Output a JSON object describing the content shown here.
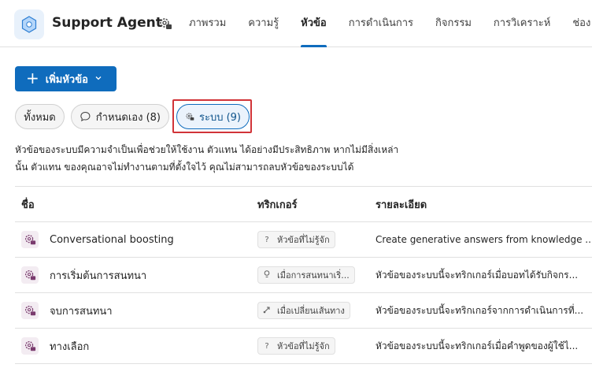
{
  "app": {
    "title": "Support Agent"
  },
  "tabs": [
    {
      "label": "ภาพรวม"
    },
    {
      "label": "ความรู้"
    },
    {
      "label": "หัวข้อ"
    },
    {
      "label": "การดำเนินการ"
    },
    {
      "label": "กิจกรรม"
    },
    {
      "label": "การวิเคราะห์"
    },
    {
      "label": "ช่อง"
    }
  ],
  "active_tab": "หัวข้อ",
  "toolbar": {
    "add_label": "เพิ่มหัวข้อ"
  },
  "filters": {
    "all": "ทั้งหมด",
    "custom": "กำหนดเอง (8)",
    "system": "ระบบ (9)"
  },
  "description": {
    "line1": "หัวข้อของระบบมีความจำเป็นเพื่อช่วยให้ใช้งาน ตัวแทน ได้อย่างมีประสิทธิภาพ หากไม่มีสิ่งเหล่า",
    "line2": "นั้น ตัวแทน ของคุณอาจไม่ทำงานตามที่ตั้งใจไว้ คุณไม่สามารถลบหัวข้อของระบบได้"
  },
  "table": {
    "columns": {
      "name": "ชื่อ",
      "trigger": "ทริกเกอร์",
      "details": "รายละเอียด"
    },
    "rows": [
      {
        "name": "Conversational boosting",
        "trigger": "หัวข้อที่ไม่รู้จัก",
        "trigger_icon": "question-icon",
        "details": "Create generative answers from knowledge ..."
      },
      {
        "name": "การเริ่มต้นการสนทนา",
        "trigger": "เมื่อการสนทนาเริ่...",
        "trigger_icon": "bulb-icon",
        "details": "หัวข้อของระบบนี้จะทริกเกอร์เมื่อบอทได้รับกิจกร..."
      },
      {
        "name": "จบการสนทนา",
        "trigger": "เมื่อเปลี่ยนเส้นทาง",
        "trigger_icon": "redirect-icon",
        "details": "หัวข้อของระบบนี้จะทริกเกอร์จากการดำเนินการที่..."
      },
      {
        "name": "ทางเลือก",
        "trigger": "หัวข้อที่ไม่รู้จัก",
        "trigger_icon": "question-icon",
        "details": "หัวข้อของระบบนี้จะทริกเกอร์เมื่อคำพูดของผู้ใช้ไ..."
      }
    ]
  },
  "colors": {
    "accent": "#0f6cbd",
    "highlight": "#d13438",
    "topic_icon": "#7a3b6e"
  }
}
